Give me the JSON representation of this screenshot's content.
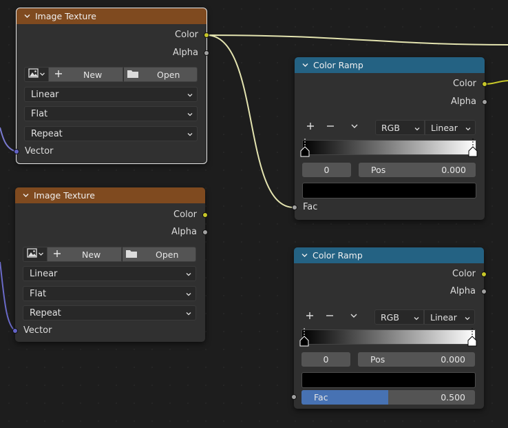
{
  "nodes": {
    "tex1": {
      "title": "Image Texture",
      "outputs": {
        "color": "Color",
        "alpha": "Alpha"
      },
      "buttons": {
        "new": "New",
        "open": "Open"
      },
      "interpolation": "Linear",
      "projection": "Flat",
      "extension": "Repeat",
      "input": "Vector"
    },
    "tex2": {
      "title": "Image Texture",
      "outputs": {
        "color": "Color",
        "alpha": "Alpha"
      },
      "buttons": {
        "new": "New",
        "open": "Open"
      },
      "interpolation": "Linear",
      "projection": "Flat",
      "extension": "Repeat",
      "input": "Vector"
    },
    "ramp1": {
      "title": "Color Ramp",
      "outputs": {
        "color": "Color",
        "alpha": "Alpha"
      },
      "color_mode": "RGB",
      "interpolation": "Linear",
      "stop_index": "0",
      "pos_label": "Pos",
      "pos_value": "0.000",
      "input": "Fac"
    },
    "ramp2": {
      "title": "Color Ramp",
      "outputs": {
        "color": "Color",
        "alpha": "Alpha"
      },
      "color_mode": "RGB",
      "interpolation": "Linear",
      "stop_index": "0",
      "pos_label": "Pos",
      "pos_value": "0.000",
      "fac_label": "Fac",
      "fac_value": "0.500",
      "fac_fraction": 0.5
    }
  },
  "colors": {
    "texture_header": "#7f4a1f",
    "converter_header": "#246283",
    "color_socket": "#c7c729",
    "float_socket": "#a1a1a1",
    "vector_socket": "#6363c7",
    "slider_fill": "#4772b3"
  },
  "icons": [
    "chevron-down-icon",
    "image-icon",
    "plus-icon",
    "minus-icon",
    "folder-icon",
    "dropdown-arrow-icon"
  ]
}
